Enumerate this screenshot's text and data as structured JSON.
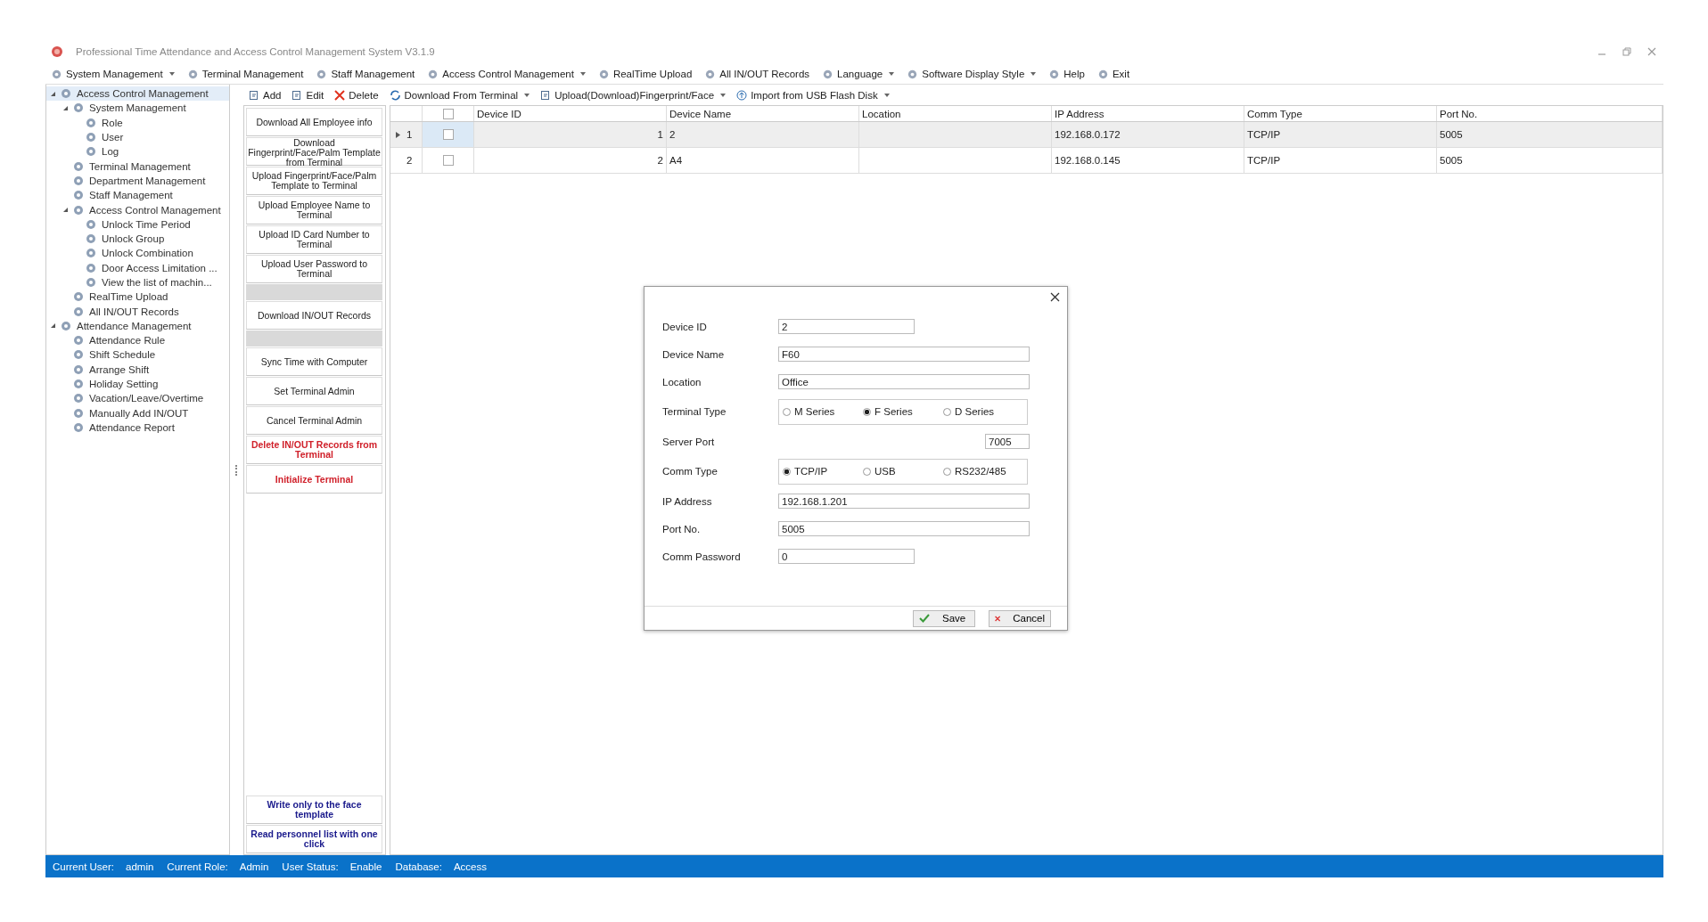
{
  "window": {
    "title": "Professional Time Attendance and Access Control Management System V3.1.9"
  },
  "menu": [
    {
      "label": "System Management",
      "dropdown": true
    },
    {
      "label": "Terminal Management",
      "dropdown": false
    },
    {
      "label": "Staff Management",
      "dropdown": false
    },
    {
      "label": "Access Control Management",
      "dropdown": true
    },
    {
      "label": "RealTime Upload",
      "dropdown": false
    },
    {
      "label": "All IN/OUT Records",
      "dropdown": false
    },
    {
      "label": "Language",
      "dropdown": true
    },
    {
      "label": "Software Display Style",
      "dropdown": true
    },
    {
      "label": "Help",
      "dropdown": false
    },
    {
      "label": "Exit",
      "dropdown": false
    }
  ],
  "sidebar": {
    "items": [
      {
        "label": "Access Control Management",
        "selected": true,
        "expanded": true,
        "children": [
          {
            "label": "System Management",
            "selected": false,
            "expanded": true,
            "children": [
              {
                "label": "Role",
                "selected": false
              },
              {
                "label": "User",
                "selected": false
              },
              {
                "label": "Log",
                "selected": false
              }
            ]
          },
          {
            "label": "Terminal Management",
            "selected": false
          },
          {
            "label": "Department Management",
            "selected": false
          },
          {
            "label": "Staff Management",
            "selected": false
          },
          {
            "label": "Access Control Management",
            "selected": false,
            "expanded": true,
            "children": [
              {
                "label": "Unlock Time Period",
                "selected": false
              },
              {
                "label": "Unlock Group",
                "selected": false
              },
              {
                "label": "Unlock Combination",
                "selected": false
              },
              {
                "label": "Door Access Limitation ...",
                "selected": false
              },
              {
                "label": "View the list of machin...",
                "selected": false
              }
            ]
          },
          {
            "label": "RealTime Upload",
            "selected": false
          },
          {
            "label": "All IN/OUT Records",
            "selected": false
          }
        ]
      },
      {
        "label": "Attendance Management",
        "selected": false,
        "expanded": true,
        "children": [
          {
            "label": "Attendance Rule",
            "selected": false
          },
          {
            "label": "Shift Schedule",
            "selected": false
          },
          {
            "label": "Arrange Shift",
            "selected": false
          },
          {
            "label": "Holiday Setting",
            "selected": false
          },
          {
            "label": "Vacation/Leave/Overtime",
            "selected": false
          },
          {
            "label": "Manually Add IN/OUT",
            "selected": false
          },
          {
            "label": "Attendance Report",
            "selected": false
          }
        ]
      }
    ]
  },
  "toolbar": [
    {
      "label": "Add",
      "kind": "add",
      "dropdown": false
    },
    {
      "label": "Edit",
      "kind": "edit",
      "dropdown": false
    },
    {
      "label": "Delete",
      "kind": "delete",
      "dropdown": false
    },
    {
      "label": "Download From Terminal",
      "kind": "download",
      "dropdown": true
    },
    {
      "label": "Upload(Download)Fingerprint/Face",
      "kind": "upload",
      "dropdown": true
    },
    {
      "label": "Import from USB Flash Disk",
      "kind": "import",
      "dropdown": true
    }
  ],
  "actions": [
    {
      "kind": "normal",
      "label": "Download All Employee info"
    },
    {
      "kind": "normal",
      "label": "Download Fingerprint/Face/Palm Template from Terminal"
    },
    {
      "kind": "normal",
      "label": "Upload Fingerprint/Face/Palm Template to Terminal"
    },
    {
      "kind": "normal",
      "label": "Upload Employee Name to Terminal"
    },
    {
      "kind": "normal",
      "label": "Upload ID Card Number to Terminal"
    },
    {
      "kind": "normal",
      "label": "Upload User Password to Terminal"
    },
    {
      "kind": "separator"
    },
    {
      "kind": "normal",
      "label": "Download IN/OUT Records"
    },
    {
      "kind": "separator"
    },
    {
      "kind": "normal",
      "label": "Sync Time with Computer"
    },
    {
      "kind": "normal",
      "label": "Set Terminal Admin"
    },
    {
      "kind": "normal",
      "label": "Cancel Terminal Admin"
    },
    {
      "kind": "danger",
      "label": "Delete IN/OUT Records from Terminal"
    },
    {
      "kind": "danger",
      "label": "Initialize Terminal"
    }
  ],
  "bottom_actions": [
    {
      "label": "Write only to the face template"
    },
    {
      "label": "Read personnel list with one click"
    }
  ],
  "table": {
    "header_checked": false,
    "columns": [
      "Device ID",
      "Device Name",
      "Location",
      "IP Address",
      "Comm Type",
      "Port No."
    ],
    "rows": [
      {
        "number": "1",
        "selected": true,
        "checked": false,
        "cells": [
          "1",
          "2",
          "",
          "192.168.0.172",
          "TCP/IP",
          "5005"
        ]
      },
      {
        "number": "2",
        "selected": false,
        "checked": false,
        "cells": [
          "2",
          "A4",
          "",
          "192.168.0.145",
          "TCP/IP",
          "5005"
        ]
      }
    ]
  },
  "dialog": {
    "fields": [
      {
        "kind": "short",
        "label": "Device ID",
        "value": "2"
      },
      {
        "kind": "text",
        "label": "Device Name",
        "value": "F60"
      },
      {
        "kind": "text",
        "label": "Location",
        "value": "Office"
      },
      {
        "kind": "radio",
        "label": "Terminal Type",
        "options": [
          {
            "label": "M Series",
            "selected": false
          },
          {
            "label": "F Series",
            "selected": true
          },
          {
            "label": "D Series",
            "selected": false
          }
        ]
      },
      {
        "kind": "port",
        "label": "Server Port",
        "value": "7005"
      },
      {
        "kind": "radio",
        "label": "Comm Type",
        "options": [
          {
            "label": "TCP/IP",
            "selected": true
          },
          {
            "label": "USB",
            "selected": false
          },
          {
            "label": "RS232/485",
            "selected": false
          }
        ]
      },
      {
        "kind": "text",
        "label": "IP Address",
        "value": "192.168.1.201"
      },
      {
        "kind": "text",
        "label": "Port No.",
        "value": "5005"
      },
      {
        "kind": "short",
        "label": "Comm Password",
        "value": "0"
      }
    ],
    "buttons": [
      {
        "kind": "save",
        "label": "Save"
      },
      {
        "kind": "cancel",
        "label": "Cancel"
      }
    ]
  },
  "status_bar": [
    {
      "label": "Current User:",
      "value": "admin"
    },
    {
      "label": "Current Role:",
      "value": "Admin"
    },
    {
      "label": "User Status:",
      "value": "Enable"
    },
    {
      "label": "Database:",
      "value": "Access"
    }
  ]
}
